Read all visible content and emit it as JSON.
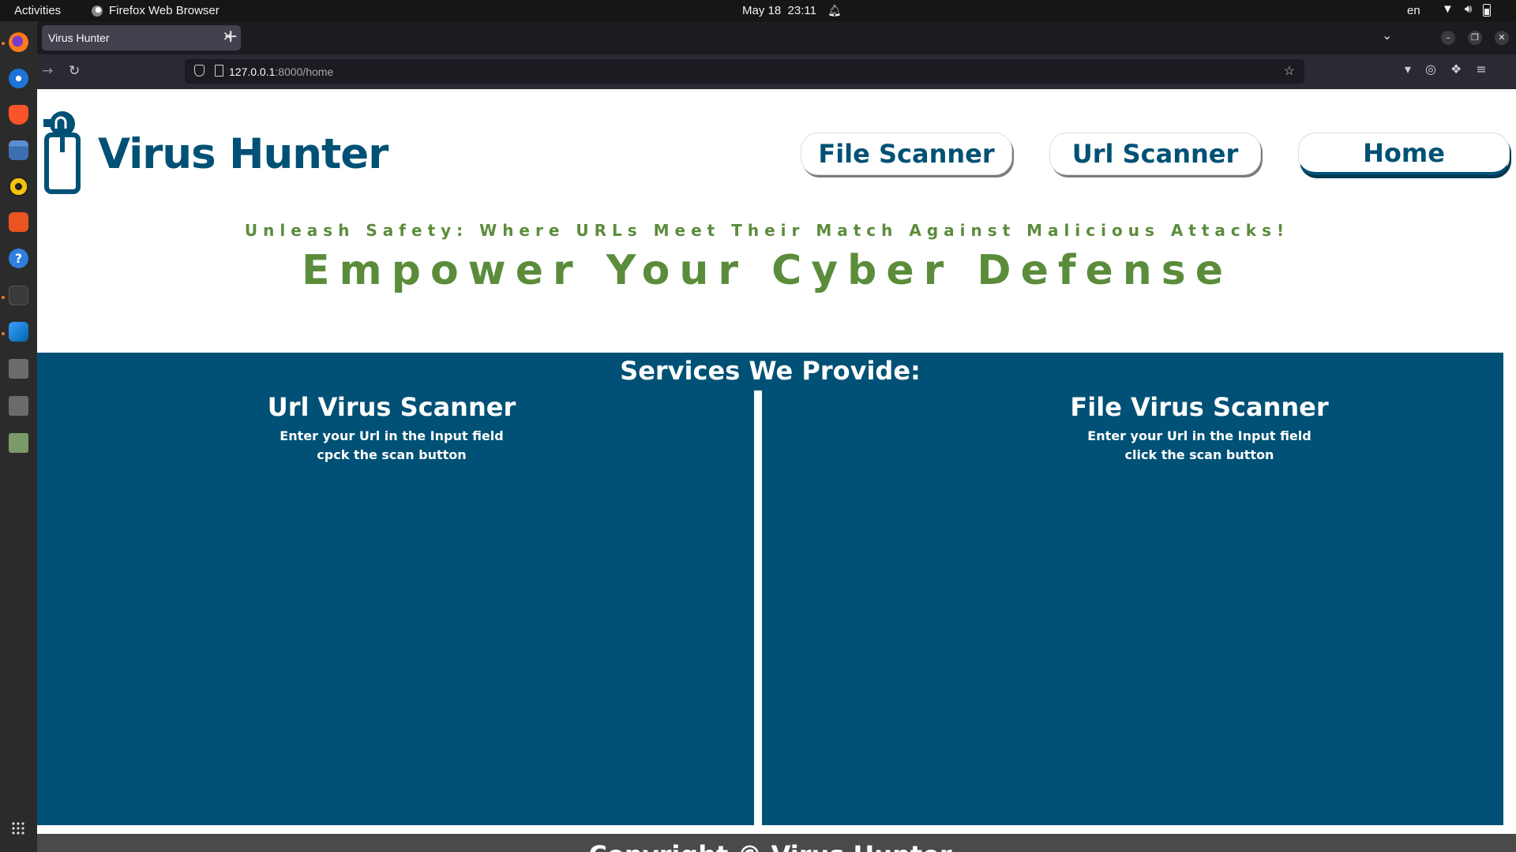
{
  "system_bar": {
    "activities": "Activities",
    "app_name": "Firefox Web Browser",
    "date": "May 18",
    "time": "23:11",
    "lang": "en"
  },
  "dock": {
    "items": [
      "firefox",
      "thunderbird",
      "brave",
      "files",
      "rhythmbox",
      "app-center",
      "help",
      "terminal",
      "vscode",
      "disk-1",
      "disk-2",
      "trash"
    ],
    "show_apps": "show-apps-grid"
  },
  "browser": {
    "tab_title": "Virus Hunter",
    "url_host": "127.0.0.1",
    "url_path": ":8000/home"
  },
  "site": {
    "brand": "Virus Hunter",
    "nav": {
      "file_scanner": "File Scanner",
      "url_scanner": "Url Scanner",
      "home": "Home"
    },
    "tagline": "Unleash Safety: Where URLs Meet Their Match Against Malicious Attacks!",
    "headline": "Empower Your Cyber Defense",
    "services": {
      "title": "Services We Provide:",
      "url_scanner": {
        "title": "Url Virus Scanner",
        "line1": "Enter your Url in the Input field",
        "line2": "cpck the scan button"
      },
      "file_scanner": {
        "title": "File Virus Scanner",
        "line1": "Enter your Url in the Input field",
        "line2": "click the scan button"
      }
    },
    "footer": "Copyright © Virus Hunter"
  },
  "colors": {
    "brand_blue": "#005175",
    "accent_green": "#5b8c3b"
  }
}
